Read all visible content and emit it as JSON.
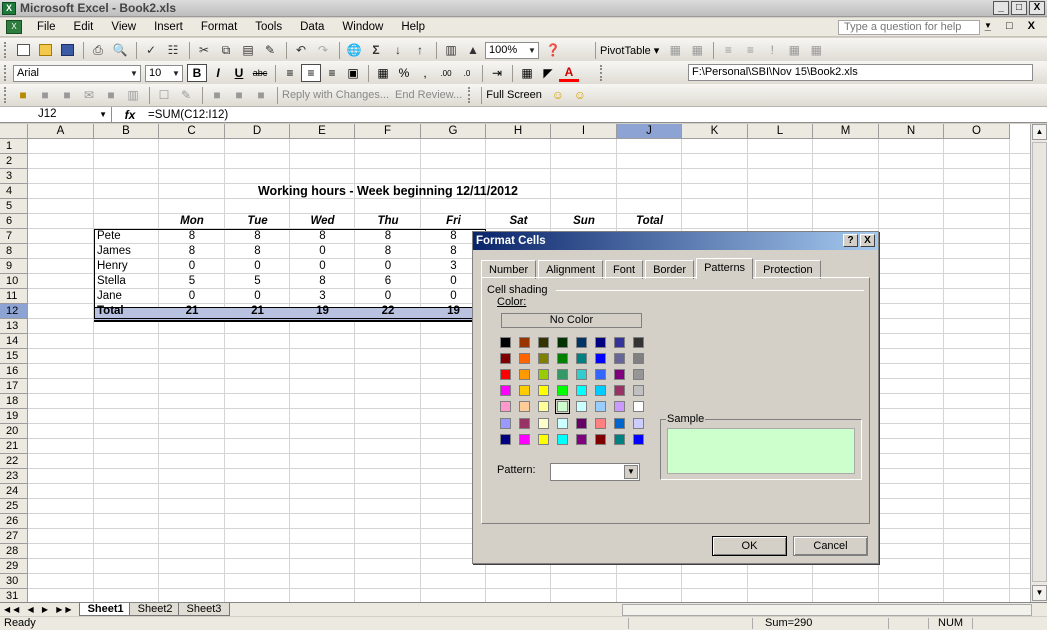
{
  "window": {
    "title": "Microsoft Excel - Book2.xls",
    "minimize": "_",
    "restore": "&#x25A1;",
    "close": "X"
  },
  "menu": {
    "items": [
      "File",
      "Edit",
      "View",
      "Insert",
      "Format",
      "Tools",
      "Data",
      "Window",
      "Help"
    ],
    "help_placeholder": "Type a question for help",
    "win_controls": "_ &#x25A1; X"
  },
  "toolbar1": {
    "zoom": "100%",
    "pivot": "PivotTable ▾"
  },
  "toolbar2": {
    "font": "Arial",
    "size": "10",
    "path": "F:\\Personal\\SBI\\Nov 15\\Book2.xls"
  },
  "toolbar3": {
    "reply": "Reply with Changes...",
    "end_review": "End Review...",
    "full_screen": "Full Screen"
  },
  "formula_bar": {
    "name_box": "J12",
    "fx": "fx",
    "formula": "=SUM(C12:I12)"
  },
  "columns": [
    "A",
    "B",
    "C",
    "D",
    "E",
    "F",
    "G",
    "H",
    "I",
    "J",
    "K",
    "L",
    "M",
    "N",
    "O"
  ],
  "rows": [
    "1",
    "2",
    "3",
    "4",
    "5",
    "6",
    "7",
    "8",
    "9",
    "10",
    "11",
    "12",
    "13",
    "14",
    "15",
    "16",
    "17",
    "18",
    "19",
    "20",
    "21",
    "22",
    "23",
    "24",
    "25",
    "26",
    "27",
    "28",
    "29",
    "30",
    "31"
  ],
  "sheet": {
    "title": "Working hours - Week beginning 12/11/2012",
    "days": [
      "Mon",
      "Tue",
      "Wed",
      "Thu",
      "Fri",
      "Sat",
      "Sun",
      "Total"
    ],
    "people": [
      {
        "name": "Pete",
        "values": [
          "8",
          "8",
          "8",
          "8",
          "8"
        ]
      },
      {
        "name": "James",
        "values": [
          "8",
          "8",
          "0",
          "8",
          "8"
        ]
      },
      {
        "name": "Henry",
        "values": [
          "0",
          "0",
          "0",
          "0",
          "3"
        ]
      },
      {
        "name": "Stella",
        "values": [
          "5",
          "5",
          "8",
          "6",
          "0"
        ]
      },
      {
        "name": "Jane",
        "values": [
          "0",
          "0",
          "3",
          "0",
          "0"
        ]
      }
    ],
    "total": {
      "label": "Total",
      "values": [
        "21",
        "21",
        "19",
        "22",
        "19"
      ]
    }
  },
  "tabs": {
    "sheets": [
      "Sheet1",
      "Sheet2",
      "Sheet3"
    ],
    "active": "Sheet1"
  },
  "status": {
    "ready": "Ready",
    "sum": "Sum=290",
    "num": "NUM"
  },
  "dialog": {
    "title": "Format Cells",
    "help": "?",
    "close": "X",
    "tabs": [
      "Number",
      "Alignment",
      "Font",
      "Border",
      "Patterns",
      "Protection"
    ],
    "active_tab": "Patterns",
    "group": "Cell shading",
    "color_label": "Color:",
    "no_color": "No Color",
    "sample_label": "Sample",
    "sample_color": "#ccffcc",
    "pattern_label": "Pattern:",
    "ok": "OK",
    "cancel": "Cancel",
    "palette": [
      [
        "#000000",
        "#993300",
        "#333300",
        "#003300",
        "#003366",
        "#000080",
        "#333399",
        "#333333"
      ],
      [
        "#800000",
        "#ff6600",
        "#808000",
        "#008000",
        "#008080",
        "#0000ff",
        "#666699",
        "#808080"
      ],
      [
        "#ff0000",
        "#ff9900",
        "#99cc00",
        "#339966",
        "#33cccc",
        "#3366ff",
        "#800080",
        "#969696"
      ],
      [
        "#ff00ff",
        "#ffcc00",
        "#ffff00",
        "#00ff00",
        "#00ffff",
        "#00ccff",
        "#993366",
        "#c0c0c0"
      ],
      [
        "#ff99cc",
        "#ffcc99",
        "#ffff99",
        "#ccffcc",
        "#ccffff",
        "#99ccff",
        "#cc99ff",
        "#ffffff"
      ]
    ],
    "palette2": [
      [
        "#9999ff",
        "#993366",
        "#ffffcc",
        "#ccffff",
        "#660066",
        "#ff8080",
        "#0066cc",
        "#ccccff"
      ],
      [
        "#000080",
        "#ff00ff",
        "#ffff00",
        "#00ffff",
        "#800080",
        "#800000",
        "#008080",
        "#0000ff"
      ]
    ],
    "selected_swatch": "#ccffcc"
  }
}
